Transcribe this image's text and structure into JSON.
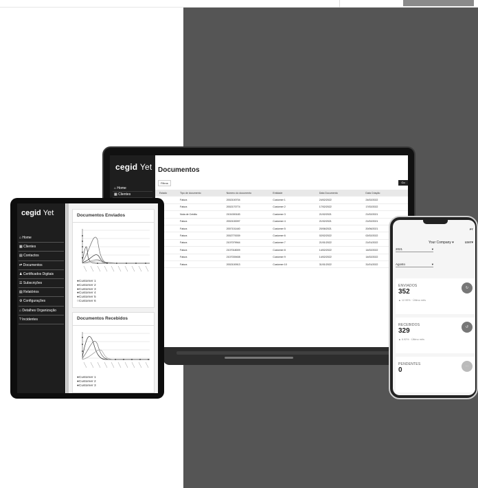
{
  "laptop": {
    "brand_main": "cegid",
    "brand_sub": "Yet",
    "nav": [
      "Home",
      "Clientes"
    ],
    "page_title": "Documentos",
    "filter_label": "Filtros",
    "filter_button": "Go",
    "table": {
      "headers": [
        "Estado",
        "Tipo de documento",
        "Número do documento",
        "Entidade",
        "Data Documento",
        "Data Criação"
      ],
      "rows": [
        [
          "",
          "Fatura",
          "2002100704",
          "Customer 1",
          "24/02/2022",
          "24/02/2022"
        ],
        [
          "",
          "Fatura",
          "2002170774",
          "Customer 2",
          "17/02/2022",
          "17/02/2022"
        ],
        [
          "",
          "Nota de Crédito",
          "2101000183",
          "Customer 3",
          "21/02/2021",
          "21/02/2021"
        ],
        [
          "",
          "Fatura",
          "2002100097",
          "Customer 4",
          "21/02/2021",
          "21/02/2021"
        ],
        [
          "",
          "Fatura",
          "2007101440",
          "Customer 5",
          "20/06/2021",
          "20/06/2021"
        ],
        [
          "",
          "Fatura",
          "2002770039",
          "Customer 6",
          "02/02/2022",
          "02/02/2022"
        ],
        [
          "",
          "Fatura",
          "2107079944",
          "Customer 7",
          "21/01/2022",
          "21/01/2022"
        ],
        [
          "",
          "Fatura",
          "2107018009",
          "Customer 8",
          "14/02/2022",
          "14/02/2022"
        ],
        [
          "",
          "Fatura",
          "2107039408",
          "Customer 9",
          "14/02/2022",
          "14/02/2022"
        ],
        [
          "",
          "Fatura",
          "2002100913",
          "Customer 10",
          "31/01/2022",
          "31/01/2022"
        ]
      ]
    }
  },
  "tablet": {
    "brand_main": "cegid",
    "brand_sub": "Yet",
    "nav": [
      "Home",
      "Clientes",
      "Contactos",
      "Documentos",
      "Certificados Digitais",
      "Subscrições",
      "Relatórios",
      "Configurações",
      "Detalhes Organização",
      "Incidentes"
    ],
    "card1": {
      "title": "Documentos Enviados",
      "legend": [
        "Customer 1",
        "Customer 2",
        "Customer 3",
        "Customer 4",
        "Customer 5",
        "Customer 6"
      ]
    },
    "card2": {
      "title": "Documentos Recebidos",
      "legend": [
        "Customer 1",
        "Customer 2",
        "Customer 3"
      ]
    }
  },
  "phone": {
    "lang": "PT",
    "company": "Your Company ▾",
    "user": "user▾",
    "select_year": "2021",
    "select_month": "Agosto",
    "cards": [
      {
        "name": "ENVIADOS",
        "value": "352",
        "sub": "▲ 12.95% · Último mês"
      },
      {
        "name": "RECEBIDOS",
        "value": "329",
        "sub": "▲ 6.92% · Último mês"
      },
      {
        "name": "PENDENTES",
        "value": "0",
        "sub": ""
      }
    ]
  }
}
